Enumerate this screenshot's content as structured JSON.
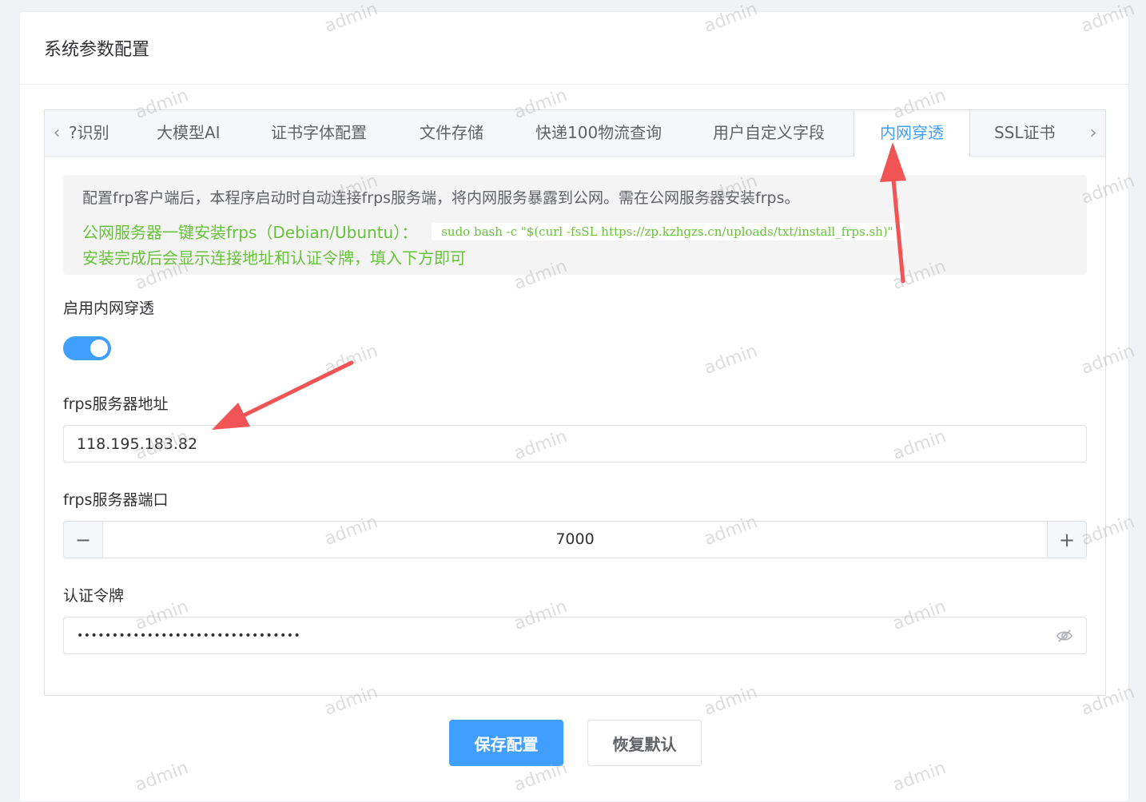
{
  "page": {
    "title": "系统参数配置"
  },
  "tabs": [
    {
      "label": "?识别"
    },
    {
      "label": "大模型AI"
    },
    {
      "label": "证书字体配置"
    },
    {
      "label": "文件存储"
    },
    {
      "label": "快递100物流查询"
    },
    {
      "label": "用户自定义字段"
    },
    {
      "label": "内网穿透",
      "active": true
    },
    {
      "label": "SSL证书"
    }
  ],
  "notice": {
    "line1": "配置frp客户端后，本程序启动时自动连接frps服务端，将内网服务暴露到公网。需在公网服务器安装frps。",
    "line2_label": "公网服务器一键安装frps（Debian/Ubuntu）：",
    "install_command": "sudo bash -c \"$(curl -fsSL https://zp.kzhgzs.cn/uploads/txt/install_frps.sh)\"",
    "line3": "安装完成后会显示连接地址和认证令牌，填入下方即可"
  },
  "form": {
    "enable_label": "启用内网穿透",
    "enable_value": true,
    "server_addr_label": "frps服务器地址",
    "server_addr_value": "118.195.183.82",
    "server_port_label": "frps服务器端口",
    "server_port_value": "7000",
    "token_label": "认证令牌",
    "token_masked": "••••••••••••••••••••••••••••••••"
  },
  "buttons": {
    "save": "保存配置",
    "reset": "恢复默认"
  },
  "watermark_text": "admin",
  "colors": {
    "primary": "#409eff",
    "success": "#67c23a",
    "annotation_arrow": "#f05454"
  }
}
